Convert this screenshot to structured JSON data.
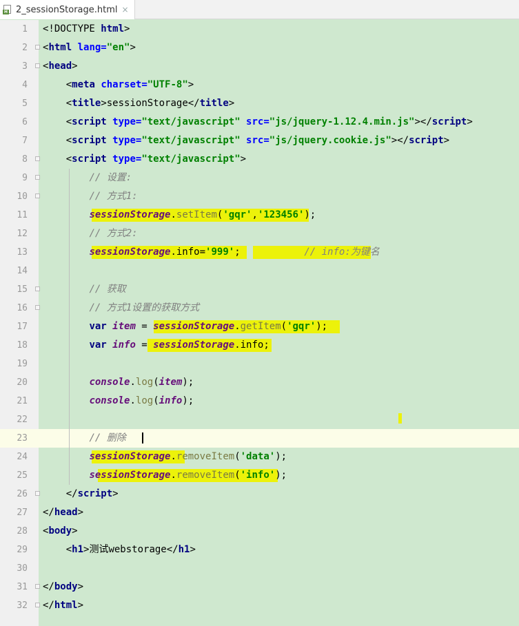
{
  "tab": {
    "file_name": "2_sessionStorage.html",
    "close_glyph": "×",
    "icon_badge": "H"
  },
  "lines": [
    {
      "n": "1",
      "parts": [
        [
          "plain",
          "<!DOCTYPE "
        ],
        [
          "tag",
          "html"
        ],
        [
          "plain",
          ">"
        ]
      ]
    },
    {
      "n": "2",
      "parts": [
        [
          "plain",
          "<"
        ],
        [
          "tag",
          "html "
        ],
        [
          "attr",
          "lang="
        ],
        [
          "str",
          "\"en\""
        ],
        [
          "plain",
          ">"
        ]
      ]
    },
    {
      "n": "3",
      "parts": [
        [
          "plain",
          "<"
        ],
        [
          "tag",
          "head"
        ],
        [
          "plain",
          ">"
        ]
      ]
    },
    {
      "n": "4",
      "parts": [
        [
          "plain",
          "    <"
        ],
        [
          "tag",
          "meta "
        ],
        [
          "attr",
          "charset="
        ],
        [
          "str",
          "\"UTF-8\""
        ],
        [
          "plain",
          ">"
        ]
      ]
    },
    {
      "n": "5",
      "parts": [
        [
          "plain",
          "    <"
        ],
        [
          "tag",
          "title"
        ],
        [
          "plain",
          ">sessionStorage</"
        ],
        [
          "tag",
          "title"
        ],
        [
          "plain",
          ">"
        ]
      ]
    },
    {
      "n": "6",
      "parts": [
        [
          "plain",
          "    <"
        ],
        [
          "tag",
          "script "
        ],
        [
          "attr",
          "type="
        ],
        [
          "str",
          "\"text/javascript\" "
        ],
        [
          "attr",
          "src="
        ],
        [
          "str",
          "\"js/jquery-1.12.4.min.js\""
        ],
        [
          "plain",
          "></"
        ],
        [
          "tag",
          "script"
        ],
        [
          "plain",
          ">"
        ]
      ]
    },
    {
      "n": "7",
      "parts": [
        [
          "plain",
          "    <"
        ],
        [
          "tag",
          "script "
        ],
        [
          "attr",
          "type="
        ],
        [
          "str",
          "\"text/javascript\" "
        ],
        [
          "attr",
          "src="
        ],
        [
          "str",
          "\"js/jquery.cookie.js\""
        ],
        [
          "plain",
          "></"
        ],
        [
          "tag",
          "script"
        ],
        [
          "plain",
          ">"
        ]
      ]
    },
    {
      "n": "8",
      "parts": [
        [
          "plain",
          "    <"
        ],
        [
          "tag",
          "script "
        ],
        [
          "attr",
          "type="
        ],
        [
          "str",
          "\"text/javascript\""
        ],
        [
          "plain",
          ">"
        ]
      ]
    },
    {
      "n": "9",
      "parts": [
        [
          "plain",
          "        "
        ],
        [
          "cmt",
          "// 设置:"
        ]
      ]
    },
    {
      "n": "10",
      "parts": [
        [
          "plain",
          "        "
        ],
        [
          "cmt",
          "// 方式1:"
        ]
      ]
    },
    {
      "n": "11",
      "parts": [
        [
          "plain",
          "        "
        ],
        [
          "ident",
          "sessionStorage"
        ],
        [
          "plain",
          "."
        ],
        [
          "meth",
          "setItem"
        ],
        [
          "plain",
          "("
        ],
        [
          "str",
          "'gqr'"
        ],
        [
          "plain",
          ","
        ],
        [
          "str",
          "'123456'"
        ],
        [
          "plain",
          ");"
        ]
      ]
    },
    {
      "n": "12",
      "parts": [
        [
          "plain",
          "        "
        ],
        [
          "cmt",
          "// 方式2:"
        ]
      ]
    },
    {
      "n": "13",
      "parts": [
        [
          "plain",
          "        "
        ],
        [
          "ident",
          "sessionStorage"
        ],
        [
          "plain",
          ".info="
        ],
        [
          "str",
          "'999'"
        ],
        [
          "plain",
          ";           "
        ],
        [
          "cmt",
          "// info:为键名"
        ]
      ]
    },
    {
      "n": "14",
      "parts": []
    },
    {
      "n": "15",
      "parts": [
        [
          "plain",
          "        "
        ],
        [
          "cmt",
          "// 获取"
        ]
      ]
    },
    {
      "n": "16",
      "parts": [
        [
          "plain",
          "        "
        ],
        [
          "cmt",
          "// 方式1设置的获取方式"
        ]
      ]
    },
    {
      "n": "17",
      "parts": [
        [
          "plain",
          "        "
        ],
        [
          "kw",
          "var "
        ],
        [
          "ident",
          "item"
        ],
        [
          "plain",
          " = "
        ],
        [
          "ident",
          "sessionStorage"
        ],
        [
          "plain",
          "."
        ],
        [
          "meth",
          "getItem"
        ],
        [
          "plain",
          "("
        ],
        [
          "str",
          "'gqr'"
        ],
        [
          "plain",
          ");"
        ]
      ]
    },
    {
      "n": "18",
      "parts": [
        [
          "plain",
          "        "
        ],
        [
          "kw",
          "var "
        ],
        [
          "ident",
          "info"
        ],
        [
          "plain",
          " = "
        ],
        [
          "ident",
          "sessionStorage"
        ],
        [
          "plain",
          ".info;"
        ]
      ]
    },
    {
      "n": "19",
      "parts": []
    },
    {
      "n": "20",
      "parts": [
        [
          "plain",
          "        "
        ],
        [
          "ident",
          "console"
        ],
        [
          "plain",
          "."
        ],
        [
          "meth",
          "log"
        ],
        [
          "plain",
          "("
        ],
        [
          "ident",
          "item"
        ],
        [
          "plain",
          ");"
        ]
      ]
    },
    {
      "n": "21",
      "parts": [
        [
          "plain",
          "        "
        ],
        [
          "ident",
          "console"
        ],
        [
          "plain",
          "."
        ],
        [
          "meth",
          "log"
        ],
        [
          "plain",
          "("
        ],
        [
          "ident",
          "info"
        ],
        [
          "plain",
          ");"
        ]
      ]
    },
    {
      "n": "22",
      "parts": []
    },
    {
      "n": "23",
      "parts": [
        [
          "plain",
          "        "
        ],
        [
          "cmt",
          "// 删除"
        ]
      ]
    },
    {
      "n": "24",
      "parts": [
        [
          "plain",
          "        "
        ],
        [
          "ident",
          "sessionStorage"
        ],
        [
          "plain",
          "."
        ],
        [
          "meth",
          "removeItem"
        ],
        [
          "plain",
          "("
        ],
        [
          "str",
          "'data'"
        ],
        [
          "plain",
          ");"
        ]
      ]
    },
    {
      "n": "25",
      "parts": [
        [
          "plain",
          "        "
        ],
        [
          "ident",
          "sessionStorage"
        ],
        [
          "plain",
          "."
        ],
        [
          "meth",
          "removeItem"
        ],
        [
          "plain",
          "("
        ],
        [
          "str",
          "'info'"
        ],
        [
          "plain",
          ");"
        ]
      ]
    },
    {
      "n": "26",
      "parts": [
        [
          "plain",
          "    </"
        ],
        [
          "tag",
          "script"
        ],
        [
          "plain",
          ">"
        ]
      ]
    },
    {
      "n": "27",
      "parts": [
        [
          "plain",
          "</"
        ],
        [
          "tag",
          "head"
        ],
        [
          "plain",
          ">"
        ]
      ]
    },
    {
      "n": "28",
      "parts": [
        [
          "plain",
          "<"
        ],
        [
          "tag",
          "body"
        ],
        [
          "plain",
          ">"
        ]
      ]
    },
    {
      "n": "29",
      "parts": [
        [
          "plain",
          "    <"
        ],
        [
          "tag",
          "h1"
        ],
        [
          "plain",
          ">测试webstorage</"
        ],
        [
          "tag",
          "h1"
        ],
        [
          "plain",
          ">"
        ]
      ]
    },
    {
      "n": "30",
      "parts": []
    },
    {
      "n": "31",
      "parts": [
        [
          "plain",
          "</"
        ],
        [
          "tag",
          "body"
        ],
        [
          "plain",
          ">"
        ]
      ]
    },
    {
      "n": "32",
      "parts": [
        [
          "plain",
          "</"
        ],
        [
          "tag",
          "html"
        ],
        [
          "plain",
          ">"
        ]
      ]
    }
  ],
  "current_line": "23",
  "folded_lines": [
    "2",
    "3",
    "8",
    "9",
    "10",
    "15",
    "16",
    "26",
    "31",
    "32"
  ],
  "colors": {
    "background": "#cfe8cf",
    "highlight": "#ecf20a",
    "current_line": "#fcfde8",
    "tag": "#000080",
    "attr": "#0000ff",
    "string": "#008000",
    "identifier": "#660e7a",
    "comment": "#808080"
  }
}
